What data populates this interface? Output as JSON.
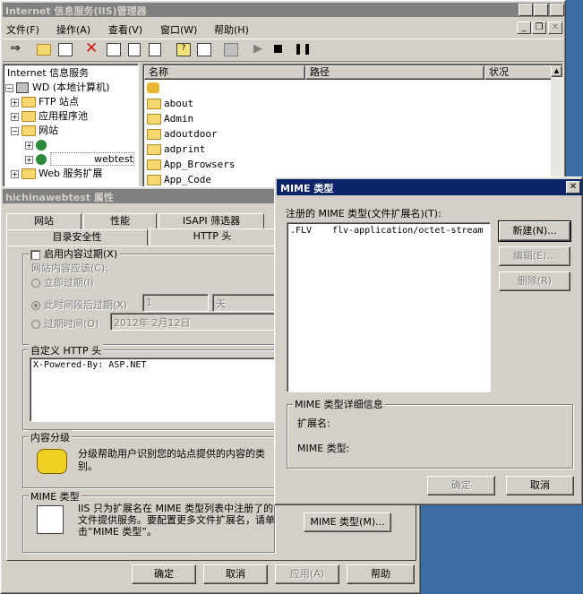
{
  "iis": {
    "title": "Internet 信息服务(IIS)管理器",
    "menu": [
      "文件(F)",
      "操作(A)",
      "查看(V)",
      "窗口(W)",
      "帮助(H)"
    ],
    "tree_root": "Internet 信息服务",
    "tree": [
      "WD      (本地计算机)",
      "FTP 站点",
      "应用程序池",
      "网站",
      "webtest",
      "Web 服务扩展"
    ],
    "columns": [
      "名称",
      "路径",
      "状况"
    ],
    "folders": [
      "about",
      "Admin",
      "adoutdoor",
      "adprint",
      "App_Browsers",
      "App_Code"
    ]
  },
  "props": {
    "title": "hichinawebtest 属性",
    "tabs_row1": [
      "网站",
      "性能",
      "ISAPI 筛选器"
    ],
    "tabs_row2": [
      "目录安全性",
      "HTTP 头"
    ],
    "enable_expire": "启用内容过期(X)",
    "expire_group": "网站内容应该(C):",
    "expire_immediately": "立即过期(I)",
    "expire_after": "此时间段后过期(X)",
    "expire_after_value": "1",
    "expire_after_unit": "天",
    "expire_on": "过期时间(O)",
    "expire_on_value": "2012年 2月12日",
    "custom_http_group": "自定义 HTTP 头",
    "custom_http_item": "X-Powered-By: ASP.NET",
    "rating_group": "内容分级",
    "rating_text": "分级帮助用户识别您的站点提供的内容的类别。",
    "mime_group": "MIME 类型",
    "mime_text": "IIS 只为扩展名在 MIME 类型列表中注册了的文件提供服务。要配置更多文件扩展名，请单击“MIME 类型”。",
    "mime_button": "MIME 类型(M)...",
    "ok": "确定",
    "cancel": "取消",
    "apply": "应用(A)",
    "help": "帮助"
  },
  "mime": {
    "title": "MIME 类型",
    "registered_label": "注册的 MIME 类型(文件扩展名)(T):",
    "entries": [
      {
        "ext": ".FLV",
        "type": "flv-application/octet-stream"
      }
    ],
    "new": "新建(N)...",
    "edit": "编辑(E)...",
    "delete": "删除(R)",
    "details_group": "MIME 类型详细信息",
    "ext_label": "扩展名:",
    "type_label": "MIME 类型:",
    "ok": "确定",
    "cancel": "取消"
  },
  "colors": {
    "desktop": "#3a6ea5",
    "active_title": "#0a246a",
    "inactive_title": "#808080",
    "face": "#d4d0c8"
  }
}
